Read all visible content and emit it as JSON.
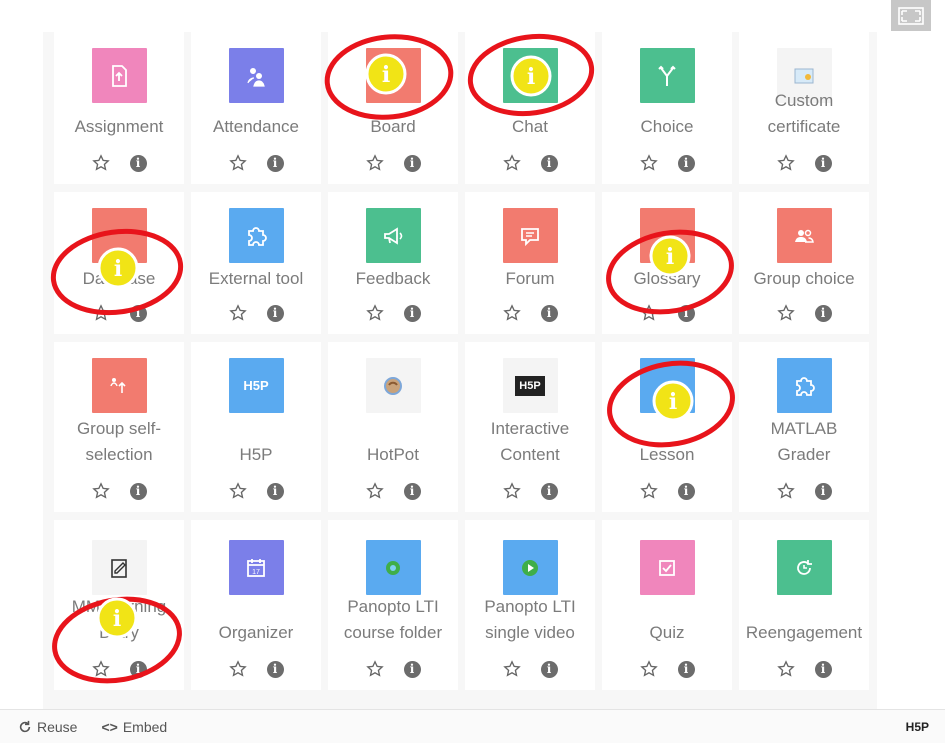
{
  "toolbar": {
    "expand_icon": "fullscreen-icon"
  },
  "activities": [
    {
      "label": "Assignment",
      "color": "#f086bc",
      "icon": "upload-doc-icon"
    },
    {
      "label": "Attendance",
      "color": "#7b7fe9",
      "icon": "people-icon"
    },
    {
      "label": "Board",
      "color": "#f27b6f",
      "icon": "board-icon"
    },
    {
      "label": "Chat",
      "color": "#4cbf8f",
      "icon": "chat-icon"
    },
    {
      "label": "Choice",
      "color": "#4cbf8f",
      "icon": "fork-arrow-icon"
    },
    {
      "label": "Custom certificate",
      "color": "#f4f4f4",
      "icon": "certificate-icon"
    },
    {
      "label": "Database",
      "color": "#f27b6f",
      "icon": "database-icon"
    },
    {
      "label": "External tool",
      "color": "#5aaaf0",
      "icon": "puzzle-icon"
    },
    {
      "label": "Feedback",
      "color": "#4cbf8f",
      "icon": "megaphone-icon"
    },
    {
      "label": "Forum",
      "color": "#f27b6f",
      "icon": "forum-icon"
    },
    {
      "label": "Glossary",
      "color": "#f27b6f",
      "icon": "glossary-icon"
    },
    {
      "label": "Group choice",
      "color": "#f27b6f",
      "icon": "group-icon"
    },
    {
      "label": "Group self-selection",
      "color": "#f27b6f",
      "icon": "group-select-icon"
    },
    {
      "label": "H5P",
      "color": "#5aaaf0",
      "icon": "h5p-icon"
    },
    {
      "label": "HotPot",
      "color": "#f4f4f4",
      "icon": "hotpot-icon"
    },
    {
      "label": "Interactive Content",
      "color": "#f4f4f4",
      "icon": "h5p-dark-icon"
    },
    {
      "label": "Lesson",
      "color": "#5aaaf0",
      "icon": "lesson-icon"
    },
    {
      "label": "MATLAB Grader",
      "color": "#5aaaf0",
      "icon": "puzzle-icon"
    },
    {
      "label": "MMLearning Diary",
      "color": "#f4f4f4",
      "icon": "diary-icon"
    },
    {
      "label": "Organizer",
      "color": "#7b7fe9",
      "icon": "calendar-icon"
    },
    {
      "label": "Panopto LTI course folder",
      "color": "#5aaaf0",
      "icon": "panopto-icon"
    },
    {
      "label": "Panopto LTI single video",
      "color": "#5aaaf0",
      "icon": "panopto-play-icon"
    },
    {
      "label": "Quiz",
      "color": "#f086bc",
      "icon": "quiz-icon"
    },
    {
      "label": "Reengagement",
      "color": "#4cbf8f",
      "icon": "reengagement-icon"
    }
  ],
  "row1_labels": [
    "Assignment",
    "Attendance",
    "Board",
    "Chat",
    "Choice",
    "Custom certificate"
  ],
  "row2_labels": [
    "Database",
    "External tool",
    "Feedback",
    "Forum",
    "Glossary",
    "Group choice"
  ],
  "row3_labels": [
    "Group self-selection",
    "H5P",
    "HotPot",
    "Interactive Content",
    "Lesson",
    "MATLAB Grader"
  ],
  "row4_labels": [
    "MMLearning Diary",
    "Organizer",
    "Panopto LTI course folder",
    "Panopto LTI single video",
    "Quiz",
    "Reengagement"
  ],
  "hotspots": [
    "Board",
    "Chat",
    "Database",
    "Glossary",
    "Lesson",
    "MMLearning Diary"
  ],
  "hotspot_icon": "i",
  "hotspot_colors": {
    "ring": "#e8141b",
    "fill": "#f1e416"
  },
  "footer": {
    "reuse_label": "Reuse",
    "embed_label": "Embed",
    "embed_icon_text": "<>",
    "logo_text": "H5P"
  }
}
